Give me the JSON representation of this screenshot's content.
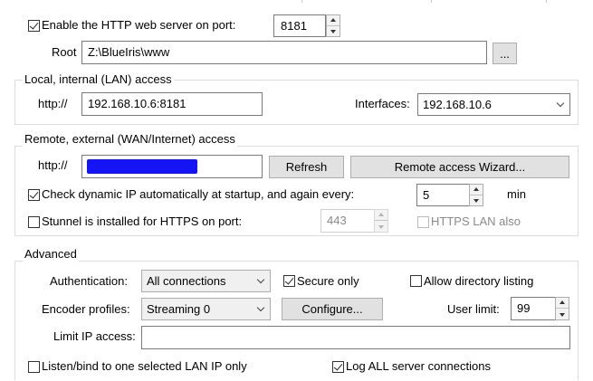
{
  "server": {
    "enable_label": "Enable the HTTP web server on port:",
    "enable_checked": true,
    "port": "8181",
    "root_label": "Root",
    "root_value": "Z:\\BlueIris\\www",
    "browse_label": "..."
  },
  "lan": {
    "title": "Local, internal (LAN) access",
    "http_label": "http://",
    "address": "192.168.10.6:8181",
    "interfaces_label": "Interfaces:",
    "interface_value": "192.168.10.6"
  },
  "wan": {
    "title": "Remote, external (WAN/Internet) access",
    "http_label": "http://",
    "refresh_label": "Refresh",
    "wizard_label": "Remote access Wizard...",
    "check_ip_label": "Check dynamic IP automatically at startup, and again every:",
    "check_ip_checked": true,
    "interval": "5",
    "interval_unit": "min",
    "stunnel_label": "Stunnel is installed for HTTPS on port:",
    "stunnel_checked": false,
    "https_port": "443",
    "https_lan_label": "HTTPS LAN also",
    "https_lan_checked": false
  },
  "advanced": {
    "title": "Advanced",
    "auth_label": "Authentication:",
    "auth_value": "All connections",
    "secure_only_label": "Secure only",
    "secure_only_checked": true,
    "dir_listing_label": "Allow directory listing",
    "dir_listing_checked": false,
    "encoder_label": "Encoder profiles:",
    "encoder_value": "Streaming 0",
    "configure_label": "Configure...",
    "user_limit_label": "User limit:",
    "user_limit": "99",
    "limit_ip_label": "Limit IP access:",
    "limit_ip_value": "",
    "listen_label": "Listen/bind to one selected LAN IP only",
    "listen_checked": false,
    "log_label": "Log ALL server connections",
    "log_checked": true
  },
  "colors": {
    "redaction": "#1414f5",
    "group_border": "#dcdcdc",
    "button_face": "#e1e1e1"
  }
}
